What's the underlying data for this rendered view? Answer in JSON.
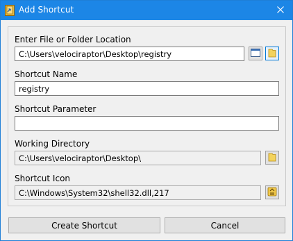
{
  "window": {
    "title": "Add Shortcut",
    "title_bar_color": "#1c86e6"
  },
  "icons": {
    "app": "shortcut-folder-icon",
    "close": "close-icon",
    "browse_file": "window-icon",
    "browse_folder": "folder-icon",
    "browse_working_dir": "folder-icon",
    "browse_icon": "icon-picker-icon"
  },
  "form": {
    "location": {
      "label": "Enter File or Folder Location",
      "value": "C:\\Users\\velociraptor\\Desktop\\registry"
    },
    "shortcut_name": {
      "label": "Shortcut Name",
      "value": "registry"
    },
    "shortcut_parameter": {
      "label": "Shortcut Parameter",
      "value": ""
    },
    "working_directory": {
      "label": "Working Directory",
      "value": "C:\\Users\\velociraptor\\Desktop\\"
    },
    "shortcut_icon": {
      "label": "Shortcut Icon",
      "value": "C:\\Windows\\System32\\shell32.dll,217"
    }
  },
  "buttons": {
    "create": "Create Shortcut",
    "cancel": "Cancel"
  }
}
